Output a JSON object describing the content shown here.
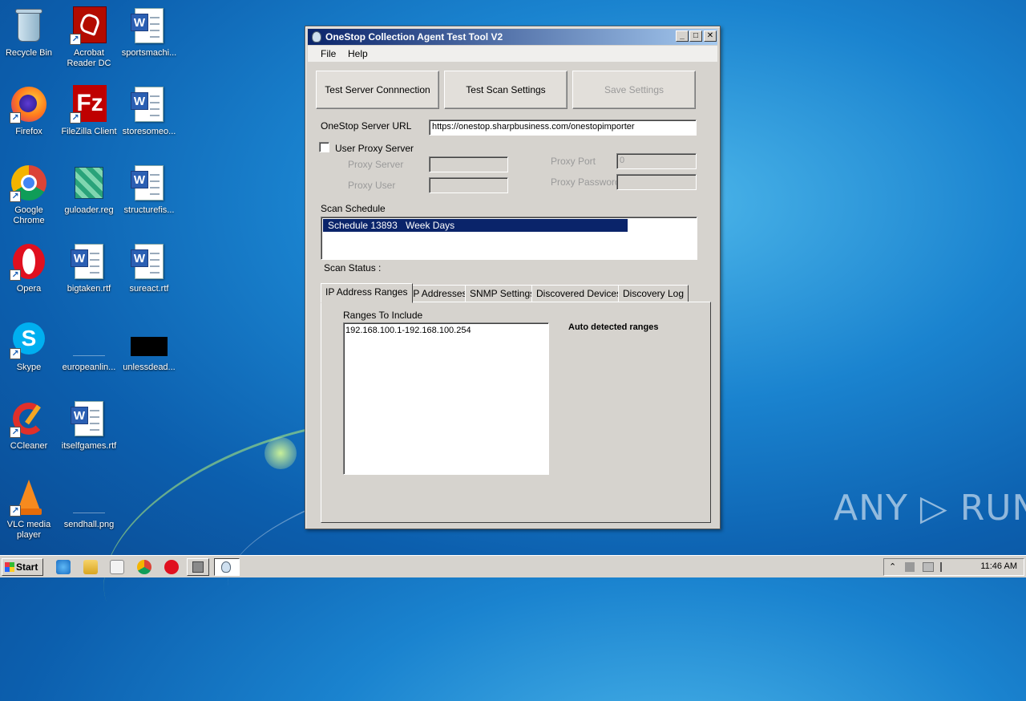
{
  "desktop": {
    "icons": [
      {
        "label": "Recycle Bin",
        "icon": "recycle-bin-icon"
      },
      {
        "label": "Acrobat Reader DC",
        "icon": "acrobat-icon"
      },
      {
        "label": "sportsmachi...",
        "icon": "word-document-icon"
      },
      {
        "label": "Firefox",
        "icon": "firefox-icon"
      },
      {
        "label": "FileZilla Client",
        "icon": "filezilla-icon"
      },
      {
        "label": "storesomeo...",
        "icon": "word-document-icon"
      },
      {
        "label": "Google Chrome",
        "icon": "chrome-icon"
      },
      {
        "label": "guloader.reg",
        "icon": "registry-file-icon"
      },
      {
        "label": "structurefis...",
        "icon": "word-document-icon"
      },
      {
        "label": "Opera",
        "icon": "opera-icon"
      },
      {
        "label": "bigtaken.rtf",
        "icon": "word-document-icon"
      },
      {
        "label": "sureact.rtf",
        "icon": "word-document-icon"
      },
      {
        "label": "Skype",
        "icon": "skype-icon"
      },
      {
        "label": "europeanlin...",
        "icon": "image-file-icon"
      },
      {
        "label": "unlessdead...",
        "icon": "image-file-icon"
      },
      {
        "label": "CCleaner",
        "icon": "ccleaner-icon"
      },
      {
        "label": "itselfgames.rtf",
        "icon": "word-document-icon"
      },
      {
        "label": "VLC media player",
        "icon": "vlc-icon"
      },
      {
        "label": "sendhall.png",
        "icon": "image-file-icon"
      }
    ]
  },
  "window": {
    "title": "OneStop Collection Agent Test Tool V2",
    "controls": {
      "minimize": "_",
      "maximize": "□",
      "close": "✕"
    },
    "menu": {
      "file": "File",
      "help": "Help"
    },
    "buttons": {
      "test_server": "Test Server Connnection",
      "test_scan": "Test Scan Settings",
      "save": "Save Settings"
    },
    "server_url_label": "OneStop Server URL",
    "server_url_value": "https://onestop.sharpbusiness.com/onestopimporter",
    "proxy": {
      "use_label": "User Proxy Server",
      "checked": false,
      "server_label": "Proxy Server",
      "server_value": "",
      "user_label": "Proxy User",
      "user_value": "",
      "port_label": "Proxy Port",
      "port_value": "0",
      "password_label": "Proxy Password",
      "password_value": ""
    },
    "scan_schedule_label": "Scan Schedule",
    "schedule_rows": [
      {
        "name": "Schedule 13893",
        "days": "Week Days"
      }
    ],
    "scan_status_label": "Scan Status :",
    "tabs": [
      "IP Address Ranges",
      "IP Addresses",
      "SNMP Settings",
      "Discovered Devices",
      "Discovery Log"
    ],
    "active_tab": "IP Address Ranges",
    "ranges_label": "Ranges To Include",
    "ranges_value": "192.168.100.1-192.168.100.254",
    "auto_detected_label": "Auto detected ranges"
  },
  "watermark": "ANY ▷ RUN",
  "taskbar": {
    "start_label": "Start",
    "clock": "11:46 AM"
  },
  "colors": {
    "title_gradient_start": "#0a246a",
    "title_gradient_end": "#a6caf0",
    "selection": "#0a246a",
    "window_face": "#d6d3ce"
  }
}
